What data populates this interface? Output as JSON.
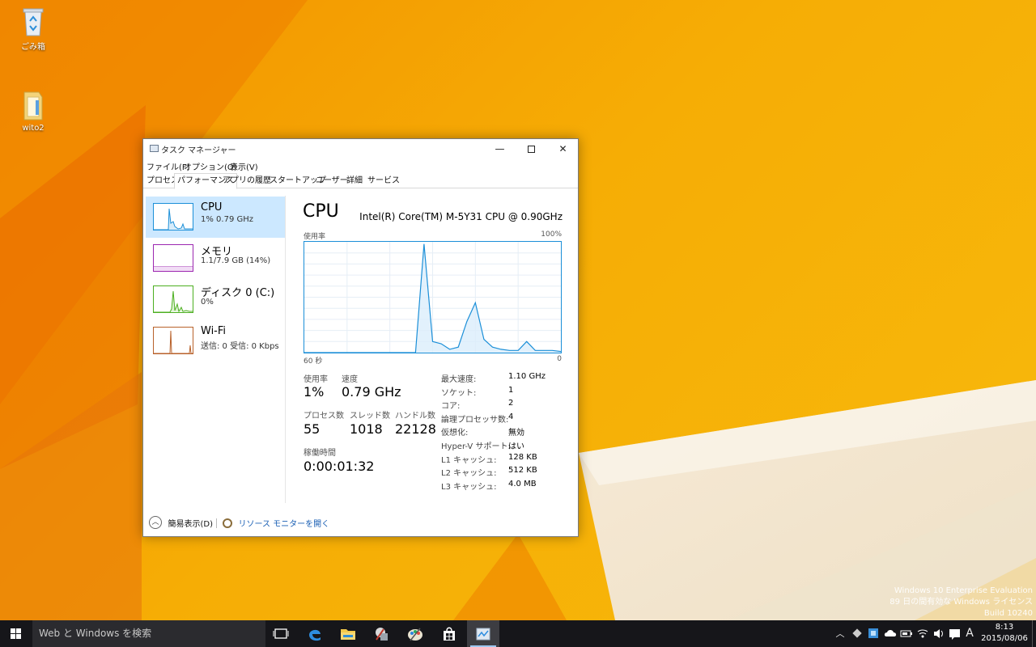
{
  "desktop": {
    "icons": [
      {
        "label": "ごみ箱",
        "icon": "recycle-bin-icon"
      },
      {
        "label": "wito2",
        "icon": "folder-icon"
      }
    ],
    "watermark": {
      "line1": "Windows 10 Enterprise Evaluation",
      "line2": "89 日の間有効な Windows ライセンス",
      "line3": "Build 10240"
    }
  },
  "window": {
    "title": "タスク マネージャー",
    "controls": {
      "minimize": "—",
      "maximize": "",
      "close": "✕"
    },
    "menu": [
      "ファイル(F)",
      "オプション(O)",
      "表示(V)"
    ],
    "tabs": [
      "プロセス",
      "パフォーマンス",
      "アプリの履歴",
      "スタートアップ",
      "ユーザー",
      "詳細",
      "サービス"
    ],
    "active_tab": "パフォーマンス",
    "sidebar": [
      {
        "name": "CPU",
        "sub": "1%  0.79 GHz",
        "color": "#1b8fd8"
      },
      {
        "name": "メモリ",
        "sub": "1.1/7.9 GB (14%)",
        "color": "#9c27b0"
      },
      {
        "name": "ディスク 0 (C:)",
        "sub": "0%",
        "color": "#4caf20"
      },
      {
        "name": "Wi-Fi",
        "sub": "送信: 0  受信: 0 Kbps",
        "color": "#b8612a"
      }
    ],
    "main": {
      "heading": "CPU",
      "model": "Intel(R) Core(TM) M-5Y31 CPU @ 0.90GHz",
      "graph_top_left": "使用率",
      "graph_top_right": "100%",
      "graph_bottom_left": "60 秒",
      "graph_bottom_right": "0",
      "stats": {
        "usage_label": "使用率",
        "usage_value": "1%",
        "speed_label": "速度",
        "speed_value": "0.79 GHz",
        "processes_label": "プロセス数",
        "processes_value": "55",
        "threads_label": "スレッド数",
        "threads_value": "1018",
        "handles_label": "ハンドル数",
        "handles_value": "22128",
        "uptime_label": "稼働時間",
        "uptime_value": "0:00:01:32"
      },
      "specs": [
        {
          "label": "最大速度:",
          "value": "1.10 GHz"
        },
        {
          "label": "ソケット:",
          "value": "1"
        },
        {
          "label": "コア:",
          "value": "2"
        },
        {
          "label": "論理プロセッサ数:",
          "value": "4"
        },
        {
          "label": "仮想化:",
          "value": "無効"
        },
        {
          "label": "Hyper-V サポート:",
          "value": "はい"
        },
        {
          "label": "L1 キャッシュ:",
          "value": "128 KB"
        },
        {
          "label": "L2 キャッシュ:",
          "value": "512 KB"
        },
        {
          "label": "L3 キャッシュ:",
          "value": "4.0 MB"
        }
      ]
    },
    "footer": {
      "fewer_details": "簡易表示(D)",
      "resource_monitor": "リソース モニターを開く"
    }
  },
  "chart_data": {
    "type": "area",
    "title": "使用率",
    "ylim": [
      0,
      100
    ],
    "x": [
      60,
      58,
      56,
      54,
      52,
      50,
      48,
      46,
      44,
      42,
      40,
      38,
      36,
      34,
      32,
      30,
      28,
      26,
      24,
      22,
      20,
      18,
      16,
      14,
      12,
      10,
      8,
      6,
      4,
      2,
      0
    ],
    "series": [
      {
        "values": [
          0,
          0,
          0,
          0,
          0,
          0,
          0,
          0,
          0,
          0,
          0,
          0,
          0,
          0,
          98,
          10,
          8,
          3,
          5,
          28,
          45,
          12,
          5,
          3,
          2,
          2,
          10,
          2,
          2,
          2,
          1
        ]
      }
    ],
    "grid": true,
    "color": "#1b8fd8"
  },
  "taskbar": {
    "search_placeholder": "Web と Windows を検索",
    "apps": [
      "task-view-icon",
      "edge-icon",
      "file-explorer-icon",
      "app-icon-a",
      "app-icon-b",
      "store-icon",
      "task-manager-icon"
    ],
    "ime": "A",
    "time": "8:13",
    "date": "2015/08/06"
  }
}
